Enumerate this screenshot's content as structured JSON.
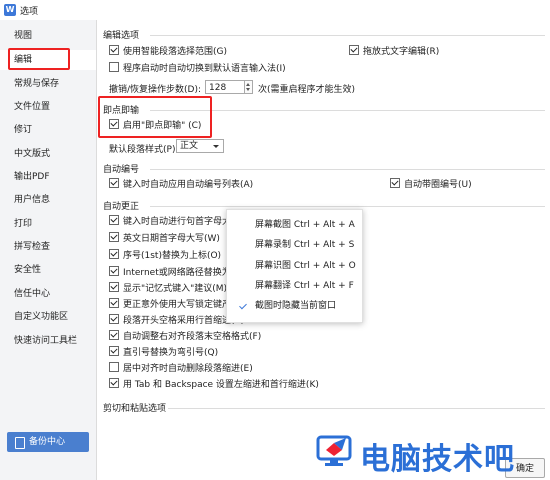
{
  "window": {
    "title": "选项",
    "app_icon_letter": "W"
  },
  "sidebar": {
    "items": [
      {
        "label": "视图"
      },
      {
        "label": "编辑"
      },
      {
        "label": "常规与保存"
      },
      {
        "label": "文件位置"
      },
      {
        "label": "修订"
      },
      {
        "label": "中文版式"
      },
      {
        "label": "输出PDF"
      },
      {
        "label": "用户信息"
      },
      {
        "label": "打印"
      },
      {
        "label": "拼写检查"
      },
      {
        "label": "安全性"
      },
      {
        "label": "信任中心"
      },
      {
        "label": "自定义功能区"
      },
      {
        "label": "快速访问工具栏"
      }
    ],
    "active": "编辑",
    "backup_button": "备份中心"
  },
  "editing": {
    "group_title": "编辑选项",
    "smart_select": "使用智能段落选择范围(G)",
    "drag_text": "拖放式文字编辑(R)",
    "auto_ime": "程序启动时自动切换到默认语言输入法(I)",
    "undo_label": "撤销/恢复操作步数(D):",
    "undo_value": "128",
    "undo_note": "次(需重启程序才能生效)"
  },
  "click_type": {
    "group_title": "即点即输",
    "enable": "启用\"即点即输\" (C)",
    "style_label": "默认段落样式(P):",
    "style_value": "正文"
  },
  "auto_number": {
    "group_title": "自动编号",
    "auto_list": "键入时自动应用自动编号列表(A)",
    "auto_circle": "自动带圈编号(U)"
  },
  "auto_correct": {
    "group_title": "自动更正",
    "items": [
      "键入时自动进行句首字母大写",
      "英文日期首字母大写(W)",
      "序号(1st)替换为上标(O)",
      "Internet或网络路径替换为超",
      "显示\"记忆式键入\"建议(M)",
      "更正意外使用大写锁定键产",
      "段落开头空格采用行首缩进(B)",
      "自动调整右对齐段落末空格格式(F)",
      "直引号替换为弯引号(Q)",
      "居中对齐时自动删除段落缩进(E)",
      "用 Tab 和 Backspace 设置左缩进和首行缩进(K)"
    ],
    "checked": [
      true,
      true,
      true,
      true,
      true,
      true,
      true,
      true,
      true,
      false,
      true
    ]
  },
  "cut_paste": {
    "group_title": "剪切和粘贴选项"
  },
  "context_menu": {
    "items": [
      "屏幕截图 Ctrl + Alt + A",
      "屏幕录制 Ctrl + Alt + S",
      "屏幕识图 Ctrl + Alt + O",
      "屏幕翻译 Ctrl + Alt + F",
      "截图时隐藏当前窗口"
    ]
  },
  "footer": {
    "confirm": "确定"
  },
  "watermark": {
    "text": "电脑技术吧"
  },
  "colors": {
    "accent": "#3d78d8",
    "highlight_box": "#ee2222",
    "watermark": "#2b6fd6"
  }
}
